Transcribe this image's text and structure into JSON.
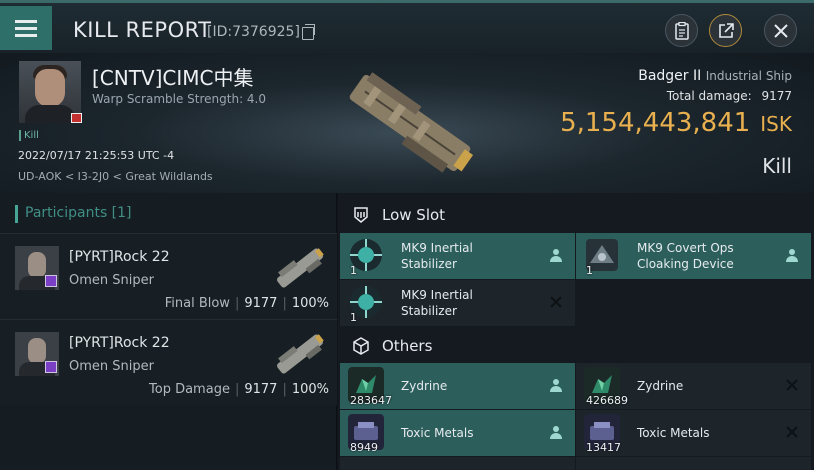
{
  "header": {
    "title": "KILL REPORT",
    "report_id": "[ID:7376925]"
  },
  "victim": {
    "pilot_name": "[CNTV]CIMC中集",
    "warp_scramble": "Warp Scramble Strength: 4.0",
    "kill_tag": "Kill",
    "datetime": "2022/07/17 21:25:53 UTC -4",
    "location": "UD-AOK < I3-2J0 < Great Wildlands"
  },
  "ship": {
    "name": "Badger II",
    "class": "Industrial Ship",
    "total_damage_label": "Total damage:",
    "total_damage": "9177",
    "isk_value": "5,154,443,841",
    "isk_unit": "ISK",
    "result": "Kill"
  },
  "participants": {
    "header": "Participants [1]",
    "rows": [
      {
        "name": "[PYRT]Rock 22",
        "ship": "Omen Sniper",
        "role": "Final Blow",
        "damage": "9177",
        "percent": "100%"
      },
      {
        "name": "[PYRT]Rock 22",
        "ship": "Omen Sniper",
        "role": "Top Damage",
        "damage": "9177",
        "percent": "100%"
      }
    ]
  },
  "low_slot": {
    "label": "Low Slot",
    "items": [
      {
        "name_line1": "MK9 Inertial",
        "name_line2": "Stabilizer",
        "qty": "1",
        "status": "dropped"
      },
      {
        "name_line1": "MK9 Covert Ops",
        "name_line2": "Cloaking Device",
        "qty": "1",
        "status": "dropped"
      },
      {
        "name_line1": "MK9 Inertial",
        "name_line2": "Stabilizer",
        "qty": "1",
        "status": "destroyed"
      }
    ]
  },
  "others": {
    "label": "Others",
    "items": [
      {
        "name": "Zydrine",
        "qty": "283647",
        "status": "dropped"
      },
      {
        "name": "Zydrine",
        "qty": "426689",
        "status": "destroyed"
      },
      {
        "name": "Toxic Metals",
        "qty": "8949",
        "status": "dropped"
      },
      {
        "name": "Toxic Metals",
        "qty": "13417",
        "status": "destroyed"
      }
    ]
  },
  "colors": {
    "accent": "#2f6f6a",
    "isk": "#e9b04f",
    "dropped_bg": "#2c5f5c"
  }
}
